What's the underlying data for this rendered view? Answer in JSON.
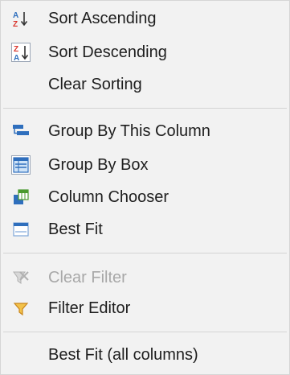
{
  "menu": {
    "items": [
      {
        "label": "Sort Ascending",
        "icon": "sort-ascending-icon",
        "enabled": true
      },
      {
        "label": "Sort Descending",
        "icon": "sort-descending-icon",
        "enabled": true,
        "selected": true
      },
      {
        "label": "Clear Sorting",
        "icon": null,
        "enabled": true
      },
      {
        "label": "Group By This Column",
        "icon": "group-by-column-icon",
        "enabled": true
      },
      {
        "label": "Group By Box",
        "icon": "group-by-box-icon",
        "enabled": true,
        "selected": true
      },
      {
        "label": "Column Chooser",
        "icon": "column-chooser-icon",
        "enabled": true
      },
      {
        "label": "Best Fit",
        "icon": "best-fit-icon",
        "enabled": true
      },
      {
        "label": "Clear Filter",
        "icon": "clear-filter-icon",
        "enabled": false
      },
      {
        "label": "Filter Editor",
        "icon": "filter-editor-icon",
        "enabled": true
      },
      {
        "label": "Best Fit (all columns)",
        "icon": null,
        "enabled": true
      }
    ]
  },
  "colors": {
    "menu_background": "#f2f2f2",
    "text": "#1e1e1e",
    "disabled_text": "#a8a8a8",
    "separator": "#d4d4d4",
    "accent_blue": "#2f6fbd",
    "accent_red": "#d9342b",
    "accent_green": "#4a9a2f",
    "filter_orange": "#e8a317"
  }
}
